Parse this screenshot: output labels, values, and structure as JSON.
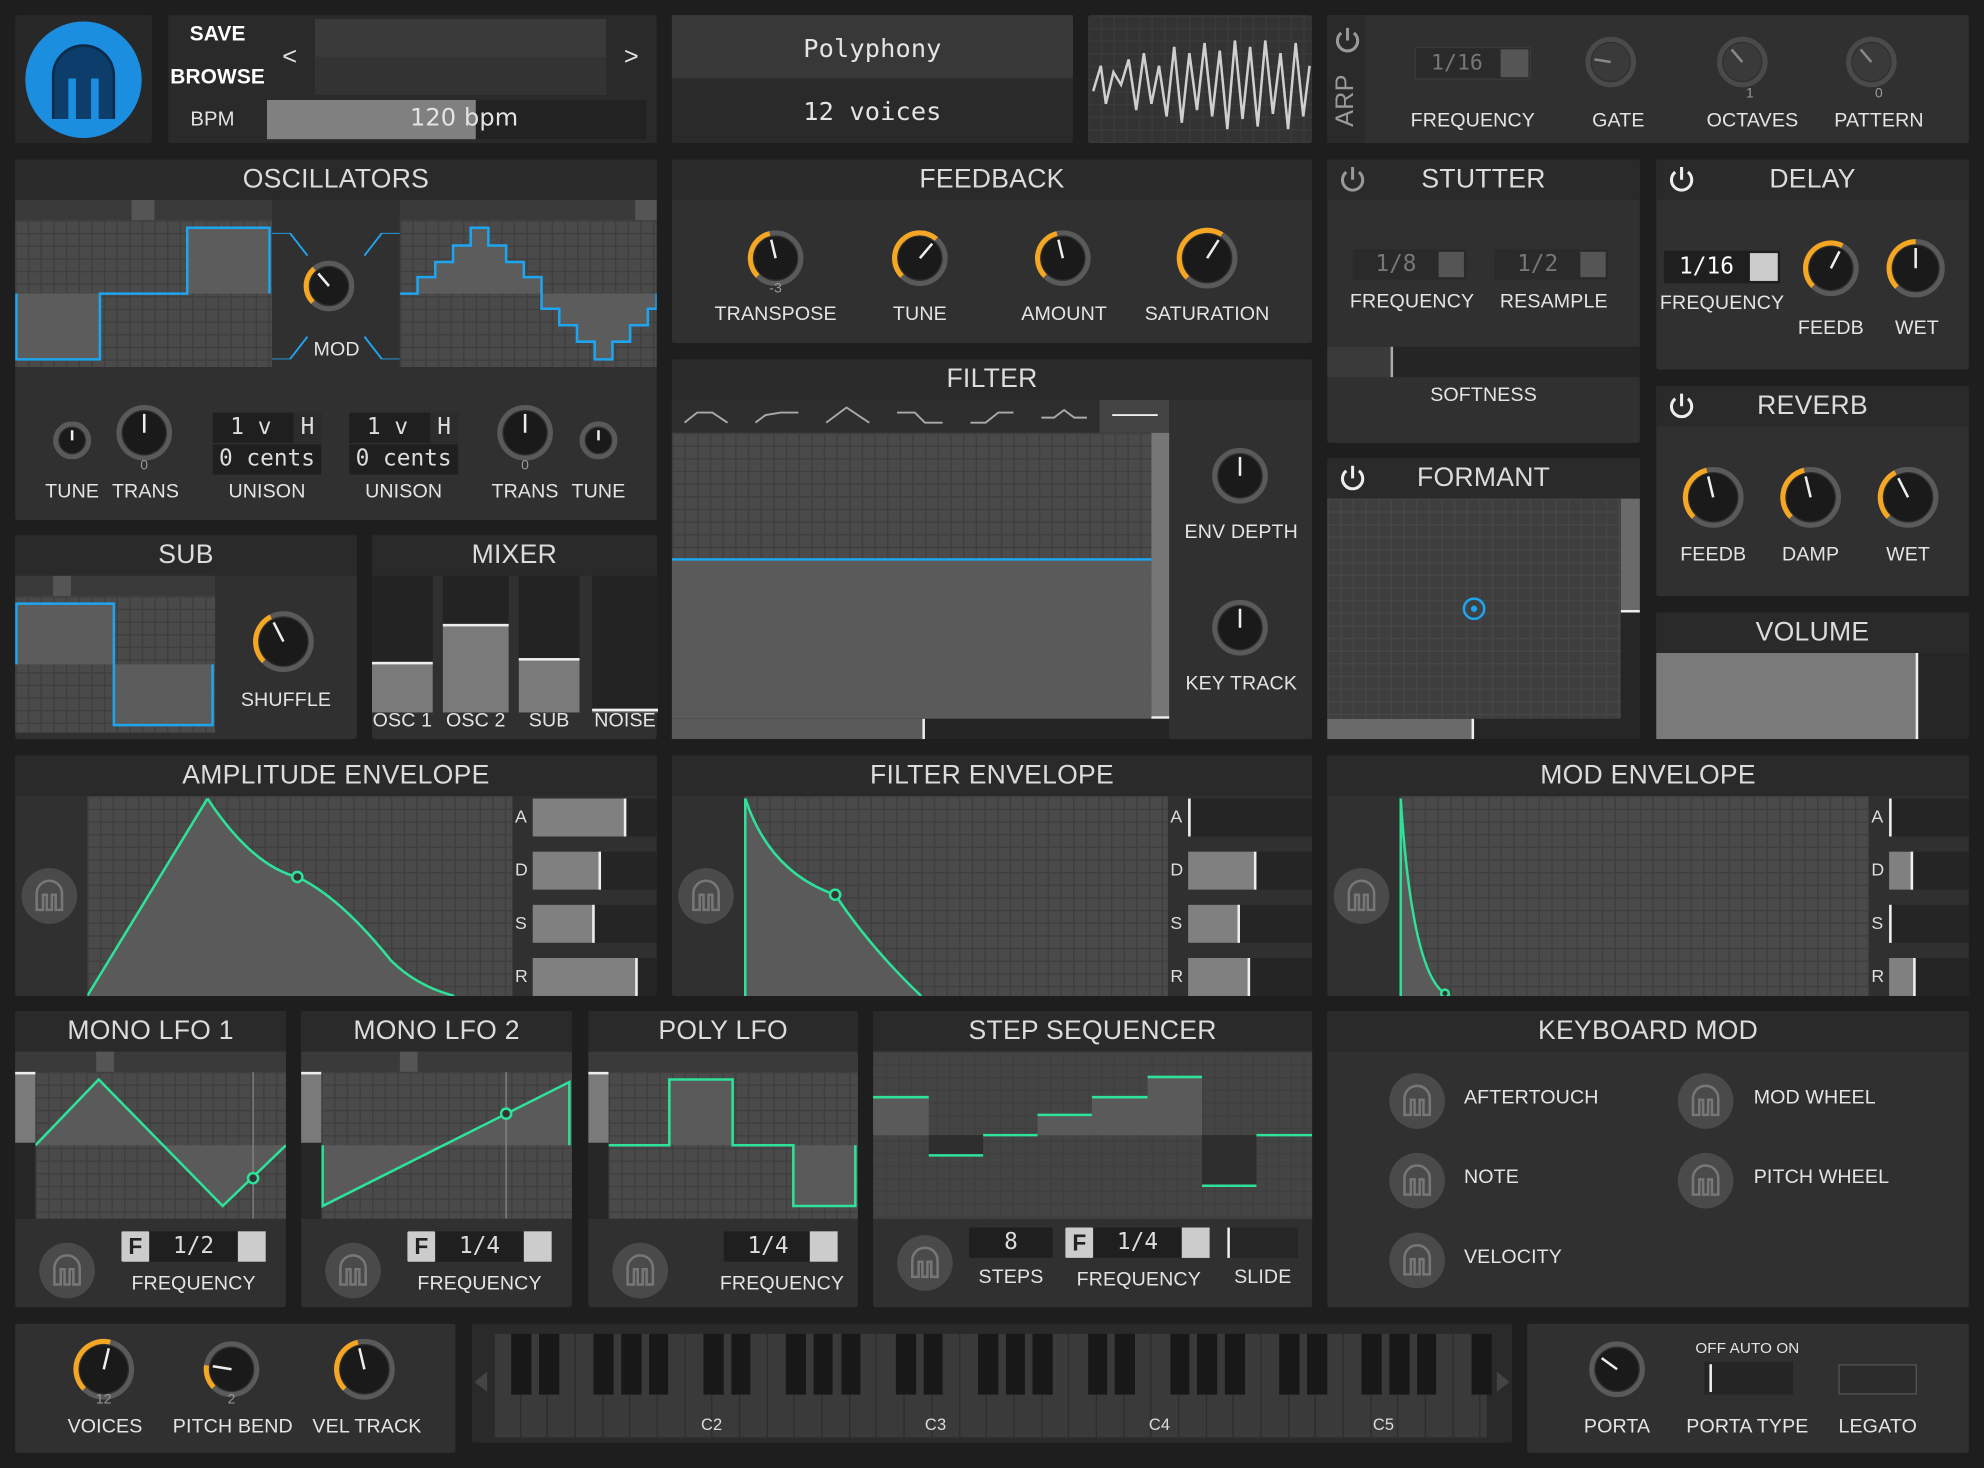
{
  "header": {
    "save": "SAVE",
    "browse": "BROWSE",
    "bpm_label": "BPM",
    "bpm_value": "120 bpm",
    "bpm_fraction": 0.55,
    "prev": "<",
    "next": ">",
    "poly_title": "Polyphony",
    "poly_value": "12 voices"
  },
  "arp": {
    "label": "ARP",
    "freq_value": "1/16",
    "freq_label": "FREQUENCY",
    "gate": "GATE",
    "octaves": "OCTAVES",
    "octaves_val": "1",
    "pattern": "PATTERN",
    "pattern_val": "0"
  },
  "oscillators": {
    "title": "OSCILLATORS",
    "mod": "MOD",
    "tune": "TUNE",
    "trans": "TRANS",
    "trans_val": "0",
    "unison_label": "UNISON",
    "unison_voices": "1 v",
    "unison_h": "H",
    "unison_cents": "0 cents"
  },
  "feedback": {
    "title": "FEEDBACK",
    "transpose": "TRANSPOSE",
    "transpose_val": "-3",
    "tune": "TUNE",
    "amount": "AMOUNT",
    "saturation": "SATURATION"
  },
  "stutter": {
    "title": "STUTTER",
    "freq_val": "1/8",
    "freq": "FREQUENCY",
    "resample_val": "1/2",
    "resample": "RESAMPLE",
    "softness": "SOFTNESS"
  },
  "delay": {
    "title": "DELAY",
    "freq_val": "1/16",
    "freq": "FREQUENCY",
    "feedb": "FEEDB",
    "wet": "WET"
  },
  "filter": {
    "title": "FILTER",
    "env_depth": "ENV DEPTH",
    "key_track": "KEY TRACK"
  },
  "formant": {
    "title": "FORMANT"
  },
  "reverb": {
    "title": "REVERB",
    "feedb": "FEEDB",
    "damp": "DAMP",
    "wet": "WET"
  },
  "volume": {
    "title": "VOLUME",
    "level": 0.84
  },
  "sub": {
    "title": "SUB",
    "shuffle": "SHUFFLE"
  },
  "mixer": {
    "title": "MIXER",
    "channels": [
      {
        "label": "OSC 1",
        "level": 0.4
      },
      {
        "label": "OSC 2",
        "level": 0.7
      },
      {
        "label": "SUB",
        "level": 0.43
      },
      {
        "label": "NOISE",
        "level": 0.03
      }
    ]
  },
  "amp_env": {
    "title": "AMPLITUDE ENVELOPE",
    "a": "A",
    "d": "D",
    "s": "S",
    "r": "R",
    "levels": [
      0.75,
      0.55,
      0.5,
      0.85
    ]
  },
  "filter_env": {
    "title": "FILTER ENVELOPE",
    "a": "A",
    "d": "D",
    "s": "S",
    "r": "R",
    "levels": [
      0.02,
      0.55,
      0.42,
      0.5
    ]
  },
  "mod_env": {
    "title": "MOD ENVELOPE",
    "a": "A",
    "d": "D",
    "s": "S",
    "r": "R",
    "levels": [
      0.02,
      0.3,
      0.02,
      0.33
    ]
  },
  "lfo1": {
    "title": "MONO LFO 1",
    "f": "F",
    "value": "1/2",
    "freq": "FREQUENCY"
  },
  "lfo2": {
    "title": "MONO LFO 2",
    "f": "F",
    "value": "1/4",
    "freq": "FREQUENCY"
  },
  "polylfo": {
    "title": "POLY LFO",
    "value": "1/4",
    "freq": "FREQUENCY"
  },
  "step": {
    "title": "STEP SEQUENCER",
    "steps_val": "8",
    "steps": "STEPS",
    "f": "F",
    "freq_val": "1/4",
    "freq": "FREQUENCY",
    "slide": "SLIDE"
  },
  "kbmod": {
    "title": "KEYBOARD MOD",
    "aftertouch": "AFTERTOUCH",
    "mod_wheel": "MOD WHEEL",
    "note": "NOTE",
    "pitch_wheel": "PITCH WHEEL",
    "velocity": "VELOCITY"
  },
  "bottom": {
    "voices": "VOICES",
    "voices_val": "12",
    "pitch_bend": "PITCH BEND",
    "pitch_bend_val": "2",
    "vel_track": "VEL TRACK",
    "porta": "PORTA",
    "porta_type": "PORTA TYPE",
    "porta_opts": "OFF AUTO  ON",
    "legato": "LEGATO"
  },
  "keyboard": {
    "c2": "C2",
    "c3": "C3",
    "c4": "C4",
    "c5": "C5"
  },
  "colors": {
    "accent": "#f5a623",
    "wave": "#1ea5f0",
    "env": "#2ee29a",
    "panel": "#303030"
  }
}
